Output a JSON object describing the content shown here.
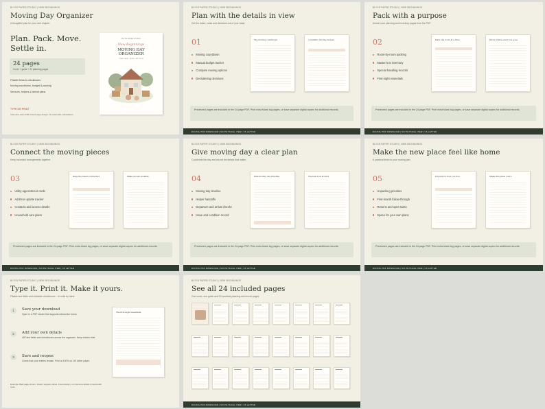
{
  "brand": "BLYSS PAPER STUDIO | NEW BEGINNINGS",
  "footer": "DIGITAL PDF DOWNLOAD | NO PHYSICAL ITEM | US LETTER",
  "note": "Previewed pages are included in the 24-page PDF. Print extra blank log pages, or save separate digital copies for additional records.",
  "colors": {
    "accent": "#c8785e",
    "dark": "#2f3c30",
    "panel": "#e0e4d7",
    "card": "#f2efe5"
  },
  "hero": {
    "title": "Moving Day Organizer",
    "subtitle": "A thoughtful plan for your next chapter.",
    "tagline": "Plan. Pack. Move. Settle in.",
    "pages_big": "24 pages",
    "pages_small": "Cover + guide + 22 planning pages",
    "list": [
      "Fillable fields & checkboxes",
      "Moving countdown, budget & packing",
      "Services, helpers & arrival plans"
    ],
    "type_label": "TYPE OR PRINT",
    "small": "View all a letter PDF. Fixed page design. No automatic calculations.",
    "cover": {
      "small": "BLYSS PAPER STUDIO",
      "script": "New Beginnings",
      "title_l1": "MOVING DAY",
      "title_l2": "ORGANIZER",
      "sub": "PLAN · PACK · MOVE · SETTLE IN"
    }
  },
  "sections": [
    {
      "title": "Plan with the details in view",
      "subtitle": "Get the dates, costs and decisions out of your head.",
      "num": "01",
      "items": [
        "Moving countdown",
        "Manual budget tracker",
        "Compare moving options",
        "Decluttering decisions"
      ],
      "pages": [
        "The moving countdown",
        "A realistic moving budget"
      ]
    },
    {
      "title": "Pack with a purpose",
      "subtitle": "Actual room planning and inventory pages from the PDF.",
      "num": "02",
      "items": [
        "Room-by-room packing",
        "Master box inventory",
        "Special handling records",
        "First-night essentials"
      ],
      "pages": [
        "Pack one room at a time",
        "Know where every box goes"
      ]
    },
    {
      "title": "Connect the moving pieces",
      "subtitle": "Keep important arrangements together.",
      "num": "03",
      "items": [
        "Utility appointment cards",
        "Address update tracker",
        "Contacts and access details",
        "Household care plans"
      ],
      "pages": [
        "Keep the basics connected",
        "Make access possible"
      ]
    },
    {
      "title": "Give moving day a clear plan",
      "subtitle": "Coordinate the day and record the details that matter.",
      "num": "04",
      "items": [
        "Moving day timeline",
        "Helper handoffs",
        "Departure and arrival checks",
        "Issue and condition record"
      ],
      "pages": [
        "Plan moving day timeline",
        "The last look around"
      ]
    },
    {
      "title": "Make the new place feel like home",
      "subtitle": "A practical finish to your moving plan.",
      "num": "05",
      "items": [
        "Unpacking priorities",
        "First-month follow-through",
        "Returns and open tasks",
        "Space for your own plans"
      ],
      "pages": [
        "Unpack for how you live",
        "Make this place yours"
      ]
    }
  ],
  "c7": {
    "title": "Type it. Print it. Make it yours.",
    "subtitle": "Fillable text fields and clickable checkboxes – or write by hand.",
    "steps": [
      {
        "n": "1",
        "title": "Save your download",
        "desc": "Open in a PDF reader that supports interactive forms."
      },
      {
        "n": "2",
        "title": "Add your own details",
        "desc": "452 text fields and checkboxes across the organizer. Keep entries brief."
      },
      {
        "n": "3",
        "title": "Save and reopen",
        "desc": "Check that your entries remain. Print at 100% on US Letter paper."
      }
    ],
    "small": "Example filled page shown. Viewer support varies. Fixed design; no Canva template or automatic tools.",
    "page": "The first-night essentials"
  },
  "c8": {
    "title": "See all 24 included pages",
    "subtitle": "One cover, one guide and 22 practical planning and record pages."
  }
}
